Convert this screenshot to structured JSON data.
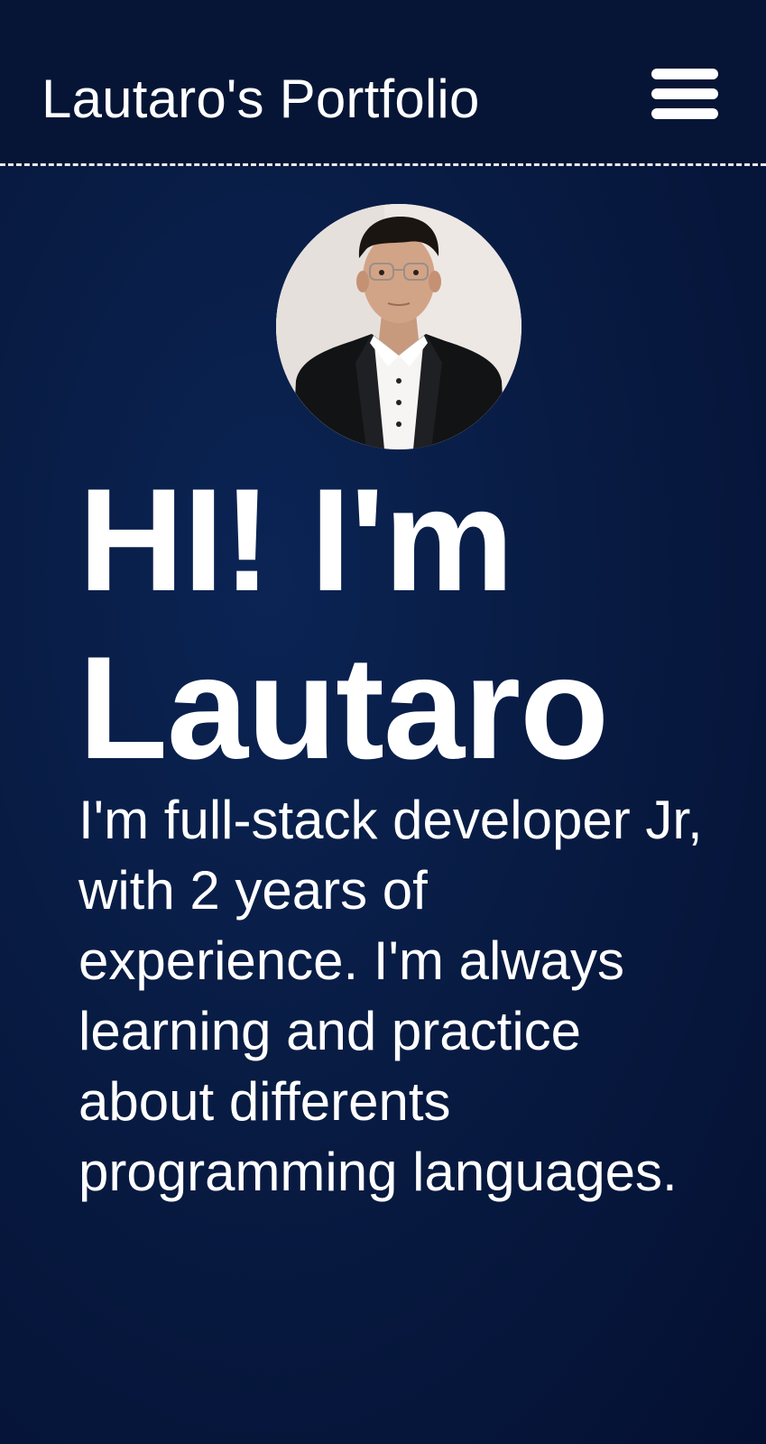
{
  "header": {
    "title": "Lautaro's Portfolio",
    "menu_icon": "hamburger-menu-icon"
  },
  "hero": {
    "avatar_icon": "profile-photo",
    "heading_line1": "HI! I'm",
    "heading_line2": "Lautaro",
    "bio": "I'm full-stack developer Jr, with 2 years of experience. I'm always learning and practice about differents programming languages."
  },
  "colors": {
    "background": "#06153a",
    "header_background": "#061535",
    "text": "#ffffff",
    "divider": "#e6ebf5"
  }
}
